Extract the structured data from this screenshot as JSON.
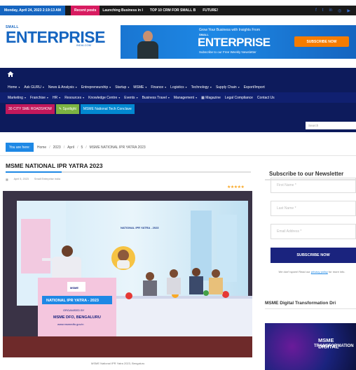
{
  "topbar": {
    "date": "Monday, April 24, 2023  2:19:13 AM",
    "recent_label": "Recent posts",
    "ticker": [
      "Launching Business in I",
      "TOP 10 CRM FOR SMALL B",
      "FUTURE!"
    ],
    "socials": [
      "f",
      "t",
      "in",
      "◎",
      "▶"
    ]
  },
  "logo": {
    "small": "SMALL",
    "big": "ENTERPRISE",
    "domain": "INDIA.COM"
  },
  "banner": {
    "tagline": "Grow Your Business with Insights From",
    "small": "SMALL",
    "big": "ENTERPRISE",
    "sub": "Subscribe to our Free Weekly Newsletter",
    "cta": "SUBSCRIBE NOW"
  },
  "nav": {
    "row1": [
      {
        "label": "Home",
        "caret": true
      },
      {
        "label": "Ask GURU",
        "caret": true
      },
      {
        "label": "News & Analysis",
        "caret": true
      },
      {
        "label": "Entrepreneurship",
        "caret": true
      },
      {
        "label": "Startup",
        "caret": true
      },
      {
        "label": "MSME",
        "caret": true
      },
      {
        "label": "Finance",
        "caret": true
      },
      {
        "label": "Logistics",
        "caret": true
      },
      {
        "label": "Technology",
        "caret": true
      },
      {
        "label": "Supply Chain",
        "caret": true
      },
      {
        "label": "Export/Import",
        "caret": false
      }
    ],
    "row2": [
      {
        "label": "Marketing",
        "caret": true
      },
      {
        "label": "Franchise",
        "caret": true
      },
      {
        "label": "HR",
        "caret": true
      },
      {
        "label": "Resources",
        "caret": true
      },
      {
        "label": "Knowledge Centre",
        "caret": true
      },
      {
        "label": "Events",
        "caret": true
      },
      {
        "label": "Business Travel",
        "caret": true
      },
      {
        "label": "Management",
        "caret": true
      },
      {
        "label": "▦ Magazine",
        "caret": false
      },
      {
        "label": "Legal Compliance",
        "caret": false
      },
      {
        "label": "Contact Us",
        "caret": false
      }
    ],
    "pills": [
      "30 CITY SME ROADSHOW",
      "✎ Spotlight",
      "MSME National Tech Conclave"
    ]
  },
  "search": {
    "placeholder": "Search"
  },
  "breadcrumb": {
    "label": "You are here:",
    "items": [
      "Home",
      "2023",
      "April",
      "5",
      "MSME NATIONAL IPR YATRA 2023"
    ]
  },
  "article": {
    "title": "MSME NATIONAL IPR YATRA 2023",
    "date": "April 5, 2023",
    "author": "Small Enterprise India",
    "stars": "★★★★★",
    "photo": {
      "backdrop_title": "NATIONAL IPR YATRA - 2023",
      "standee_title": "NATIONAL IPR YATRA - 2023",
      "standee_org1": "ORGANISED BY",
      "standee_org2": "MSME DFO, BENGALURU",
      "standee_url": "www.msmedfo.gov.in",
      "logo_text": "MSME"
    },
    "caption": "MSME National IPR Yatra 2023, Bengaluru"
  },
  "sidebar": {
    "newsletter_title": "Subscribe to our Newsletter",
    "first_name": "First Name *",
    "last_name": "Last Name *",
    "email": "Email Address *",
    "subscribe": "SUBSCRIBE NOW",
    "spam_text": "We don't spam! Read our",
    "privacy_link": "privacy policy",
    "spam_more": "for more info.",
    "section2_title": "MSME Digital Transformation Dri",
    "promo_t1": "MSME DIGITAL",
    "promo_t2": "TRANSFORMATION"
  },
  "colors": {
    "brand_blue": "#1565c0",
    "nav_bg": "#0d1b5c",
    "accent_orange": "#f57c00",
    "pink": "#d81b60"
  }
}
